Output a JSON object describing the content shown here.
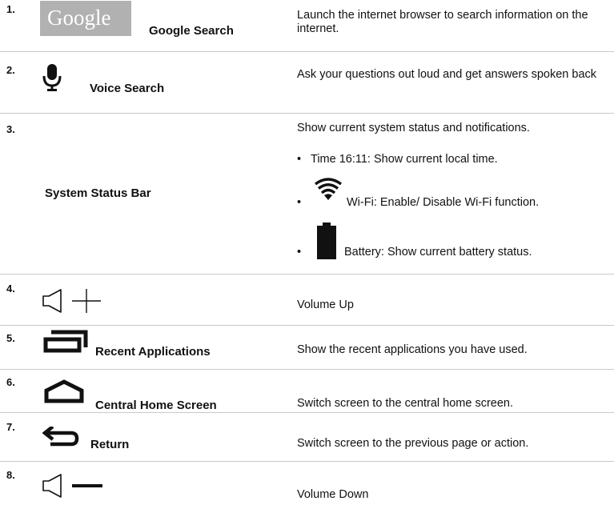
{
  "rows": [
    {
      "num": "1.",
      "label": "Google Search",
      "logo_text": "Google",
      "desc": "Launch the internet browser to search information on the internet."
    },
    {
      "num": "2.",
      "label": "Voice Search",
      "desc": "Ask your questions out loud and get answers spoken back"
    },
    {
      "num": "3.",
      "label": "System Status Bar",
      "desc": "Show current system status and notifications.",
      "bullets": [
        {
          "text": "Time 16:11: Show current local time."
        },
        {
          "text": "Wi-Fi: Enable/ Disable Wi-Fi function."
        },
        {
          "text": "Battery: Show current battery status."
        }
      ]
    },
    {
      "num": "4.",
      "label": "",
      "desc": "Volume Up"
    },
    {
      "num": "5.",
      "label": "Recent Applications",
      "desc": "Show the recent applications you have used."
    },
    {
      "num": "6.",
      "label": "Central Home Screen",
      "desc": "Switch screen to the central home screen."
    },
    {
      "num": "7.",
      "label": "Return",
      "desc": "Switch screen to the previous page or action."
    },
    {
      "num": "8.",
      "label": "",
      "desc": "Volume Down"
    }
  ],
  "bullet_char": "•",
  "icons": [
    "google-logo",
    "microphone-icon",
    "wifi-icon",
    "battery-icon",
    "volume-up-icon",
    "recent-apps-icon",
    "home-icon",
    "back-icon",
    "volume-down-icon"
  ]
}
